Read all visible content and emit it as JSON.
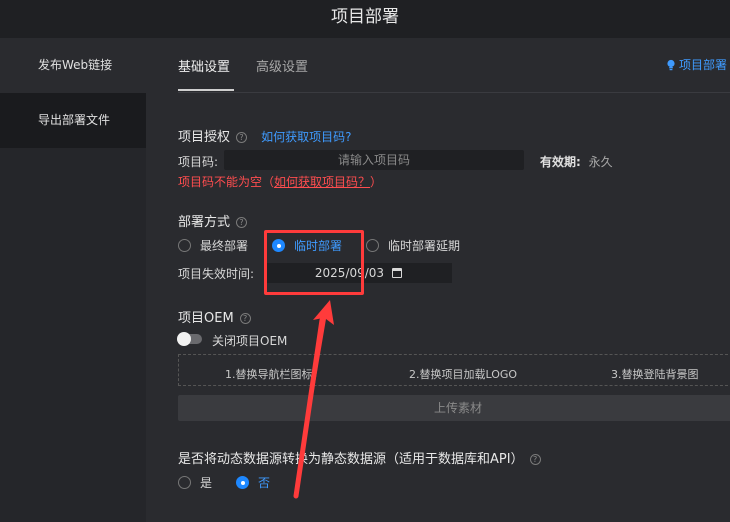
{
  "window": {
    "title": "项目部署"
  },
  "sidebar": {
    "items": [
      {
        "label": "发布Web链接"
      },
      {
        "label": "导出部署文件"
      }
    ]
  },
  "tabs": [
    {
      "label": "基础设置",
      "active": true
    },
    {
      "label": "高级设置",
      "active": false
    }
  ],
  "help_link": "项目部署",
  "auth": {
    "title": "项目授权",
    "title_link": "如何获取项目码?",
    "code_label": "项目码:",
    "code_placeholder": "请输入项目码",
    "code_value": "",
    "validity_label": "有效期:",
    "validity_value": "永久",
    "error_prefix": "项目码不能为空（",
    "error_link": "如何获取项目码？",
    "error_suffix": "）"
  },
  "deploy": {
    "title": "部署方式",
    "options": [
      {
        "label": "最终部署",
        "checked": false
      },
      {
        "label": "临时部署",
        "checked": true
      },
      {
        "label": "临时部署延期",
        "checked": false
      }
    ],
    "expire_label": "项目失效时间:",
    "expire_value": "2025/09/03"
  },
  "oem": {
    "title": "项目OEM",
    "toggle_label": "关闭项目OEM",
    "toggle_on": false,
    "items": [
      "1.替换导航栏图标",
      "2.替换项目加载LOGO",
      "3.替换登陆背景图"
    ],
    "upload_label": "上传素材"
  },
  "static_source": {
    "title": "是否将动态数据源转换为静态数据源（适用于数据库和API）",
    "options": [
      {
        "label": "是",
        "checked": false
      },
      {
        "label": "否",
        "checked": true
      }
    ]
  },
  "colors": {
    "accent": "#1e88ff",
    "error": "#ff4d4f",
    "annotation": "#ff3b3b"
  }
}
